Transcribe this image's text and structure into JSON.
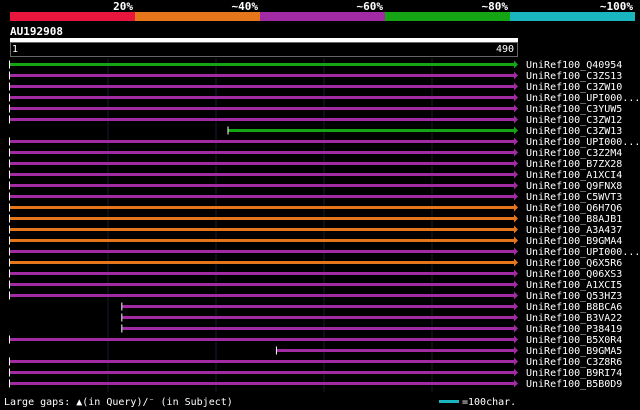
{
  "scale": {
    "labels": [
      "20%",
      "~40%",
      "~60%",
      "~80%",
      "~100%"
    ],
    "colors": [
      "#e8163c",
      "#e6761c",
      "#a22aa2",
      "#14a414",
      "#1ab6c0"
    ]
  },
  "query": {
    "name": "AU192908",
    "start_label": "1",
    "end_label": "490",
    "length": 490
  },
  "hits": [
    {
      "label": "UniRef100_Q40954",
      "color": "#14a414",
      "start": 1,
      "end": 490
    },
    {
      "label": "UniRef100_C3ZS13",
      "color": "#a22aa2",
      "start": 1,
      "end": 490
    },
    {
      "label": "UniRef100_C3ZW10",
      "color": "#a22aa2",
      "start": 1,
      "end": 490
    },
    {
      "label": "UniRef100_UPI000...",
      "color": "#a22aa2",
      "start": 1,
      "end": 490
    },
    {
      "label": "UniRef100_C3YUW5",
      "color": "#a22aa2",
      "start": 1,
      "end": 490
    },
    {
      "label": "UniRef100_C3ZW12",
      "color": "#a22aa2",
      "start": 1,
      "end": 490
    },
    {
      "label": "UniRef100_C3ZW13",
      "color": "#14a414",
      "start": 213,
      "end": 490
    },
    {
      "label": "UniRef100_UPI000...",
      "color": "#a22aa2",
      "start": 1,
      "end": 490
    },
    {
      "label": "UniRef100_C3Z2M4",
      "color": "#a22aa2",
      "start": 1,
      "end": 490
    },
    {
      "label": "UniRef100_B7ZX28",
      "color": "#a22aa2",
      "start": 1,
      "end": 490
    },
    {
      "label": "UniRef100_A1XCI4",
      "color": "#a22aa2",
      "start": 1,
      "end": 490
    },
    {
      "label": "UniRef100_Q9FNX8",
      "color": "#a22aa2",
      "start": 1,
      "end": 490
    },
    {
      "label": "UniRef100_C5WVT3",
      "color": "#a22aa2",
      "start": 1,
      "end": 490
    },
    {
      "label": "UniRef100_Q6H7Q6",
      "color": "#e6761c",
      "start": 1,
      "end": 490
    },
    {
      "label": "UniRef100_B8AJB1",
      "color": "#e6761c",
      "start": 1,
      "end": 490
    },
    {
      "label": "UniRef100_A3A437",
      "color": "#e6761c",
      "start": 1,
      "end": 490
    },
    {
      "label": "UniRef100_B9GMA4",
      "color": "#e6761c",
      "start": 1,
      "end": 490
    },
    {
      "label": "UniRef100_UPI000...",
      "color": "#a22aa2",
      "start": 1,
      "end": 490
    },
    {
      "label": "UniRef100_Q6X5R6",
      "color": "#e6761c",
      "start": 1,
      "end": 490
    },
    {
      "label": "UniRef100_Q06XS3",
      "color": "#a22aa2",
      "start": 1,
      "end": 490
    },
    {
      "label": "UniRef100_A1XCI5",
      "color": "#a22aa2",
      "start": 1,
      "end": 490
    },
    {
      "label": "UniRef100_Q53HZ3",
      "color": "#a22aa2",
      "start": 1,
      "end": 490
    },
    {
      "label": "UniRef100_B8BCA6",
      "color": "#a22aa2",
      "start": 110,
      "end": 490
    },
    {
      "label": "UniRef100_B3VA22",
      "color": "#a22aa2",
      "start": 110,
      "end": 490
    },
    {
      "label": "UniRef100_P38419",
      "color": "#a22aa2",
      "start": 110,
      "end": 490
    },
    {
      "label": "UniRef100_B5X0R4",
      "color": "#a22aa2",
      "start": 1,
      "end": 490
    },
    {
      "label": "UniRef100_B9GMA5",
      "color": "#a22aa2",
      "start": 260,
      "end": 490
    },
    {
      "label": "UniRef100_C3Z8R6",
      "color": "#a22aa2",
      "start": 1,
      "end": 490
    },
    {
      "label": "UniRef100_B9RI74",
      "color": "#a22aa2",
      "start": 1,
      "end": 490
    },
    {
      "label": "UniRef100_B5B0D9",
      "color": "#a22aa2",
      "start": 1,
      "end": 490
    }
  ],
  "legend": {
    "gaps_text": "Large gaps: ▲(in Query)/⁻ (in Subject)",
    "scale_text": "=100char.",
    "scale_color": "#1ab6c0"
  }
}
